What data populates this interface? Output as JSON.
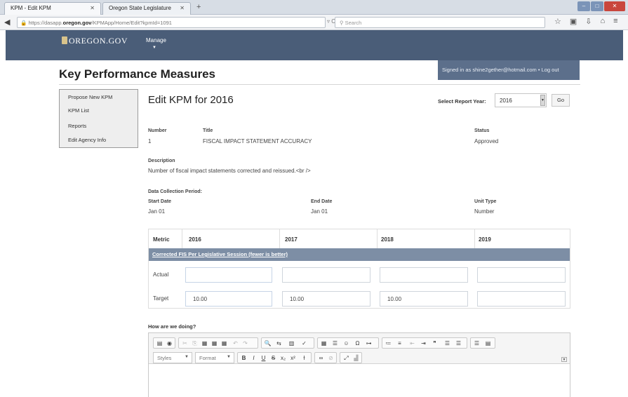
{
  "browser": {
    "tabs": [
      {
        "title": "KPM - Edit KPM"
      },
      {
        "title": "Oregon State Legislature"
      }
    ],
    "url_prefix": "https://dasapp.",
    "url_domain": "oregon.gov",
    "url_path": "/KPMApp/Home/Edit?kpmId=1091",
    "search_placeholder": "Search"
  },
  "site": {
    "logo_text": "OREGON.GOV",
    "nav_manage": "Manage",
    "page_title": "Key Performance Measures",
    "signin_text": "Signed in as shine2gether@hotmail.com • Log out"
  },
  "sidebar": {
    "items": [
      {
        "label": "Propose New KPM"
      },
      {
        "label": "KPM List"
      },
      {
        "label": "Reports"
      },
      {
        "label": "Edit Agency Info"
      }
    ]
  },
  "main": {
    "heading": "Edit KPM for 2016",
    "select_year_label": "Select Report Year:",
    "select_year_value": "2016",
    "go_label": "Go",
    "number_label": "Number",
    "number_value": "1",
    "title_label": "Title",
    "title_value": "FISCAL IMPACT STATEMENT ACCURACY",
    "status_label": "Status",
    "status_value": "Approved",
    "description_label": "Description",
    "description_value": "Number of fiscal impact statements corrected and reissued.<br />",
    "dcp_label": "Data Collection Period:",
    "start_label": "Start Date",
    "start_value": "Jan 01",
    "end_label": "End Date",
    "end_value": "Jan 01",
    "unit_label": "Unit Type",
    "unit_value": "Number"
  },
  "kpm_table": {
    "headers": [
      "Metric",
      "2016",
      "2017",
      "2018",
      "2019"
    ],
    "band_label": "Corrected FIS Per Legislative Session (fewer is better)",
    "rows": [
      {
        "label": "Actual",
        "values": [
          "",
          "",
          "",
          ""
        ]
      },
      {
        "label": "Target",
        "values": [
          "10.00",
          "10.00",
          "10.00",
          ""
        ]
      }
    ]
  },
  "editor": {
    "prompt": "How are we doing?",
    "styles_label": "Styles",
    "format_label": "Format"
  }
}
